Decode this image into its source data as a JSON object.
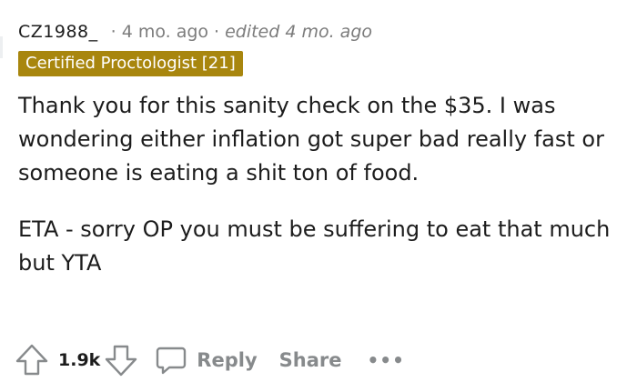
{
  "comment": {
    "author": "CZ1988_",
    "separator": "·",
    "age": "4 mo. ago",
    "edited": "edited 4 mo. ago",
    "flair": "Certified Proctologist [21]",
    "flair_color": "#a8860e",
    "paragraphs": [
      "Thank you for this sanity check on the $35. I was wondering either inflation got super bad really fast or someone is eating a shit ton of food.",
      "ETA - sorry OP you must be suffering to eat that much but YTA"
    ]
  },
  "actions": {
    "upvote_icon": "upvote-arrow-icon",
    "vote_count": "1.9k",
    "downvote_icon": "downvote-arrow-icon",
    "reply_icon": "speech-bubble-icon",
    "reply_label": "Reply",
    "share_label": "Share",
    "more_label": "•••"
  }
}
